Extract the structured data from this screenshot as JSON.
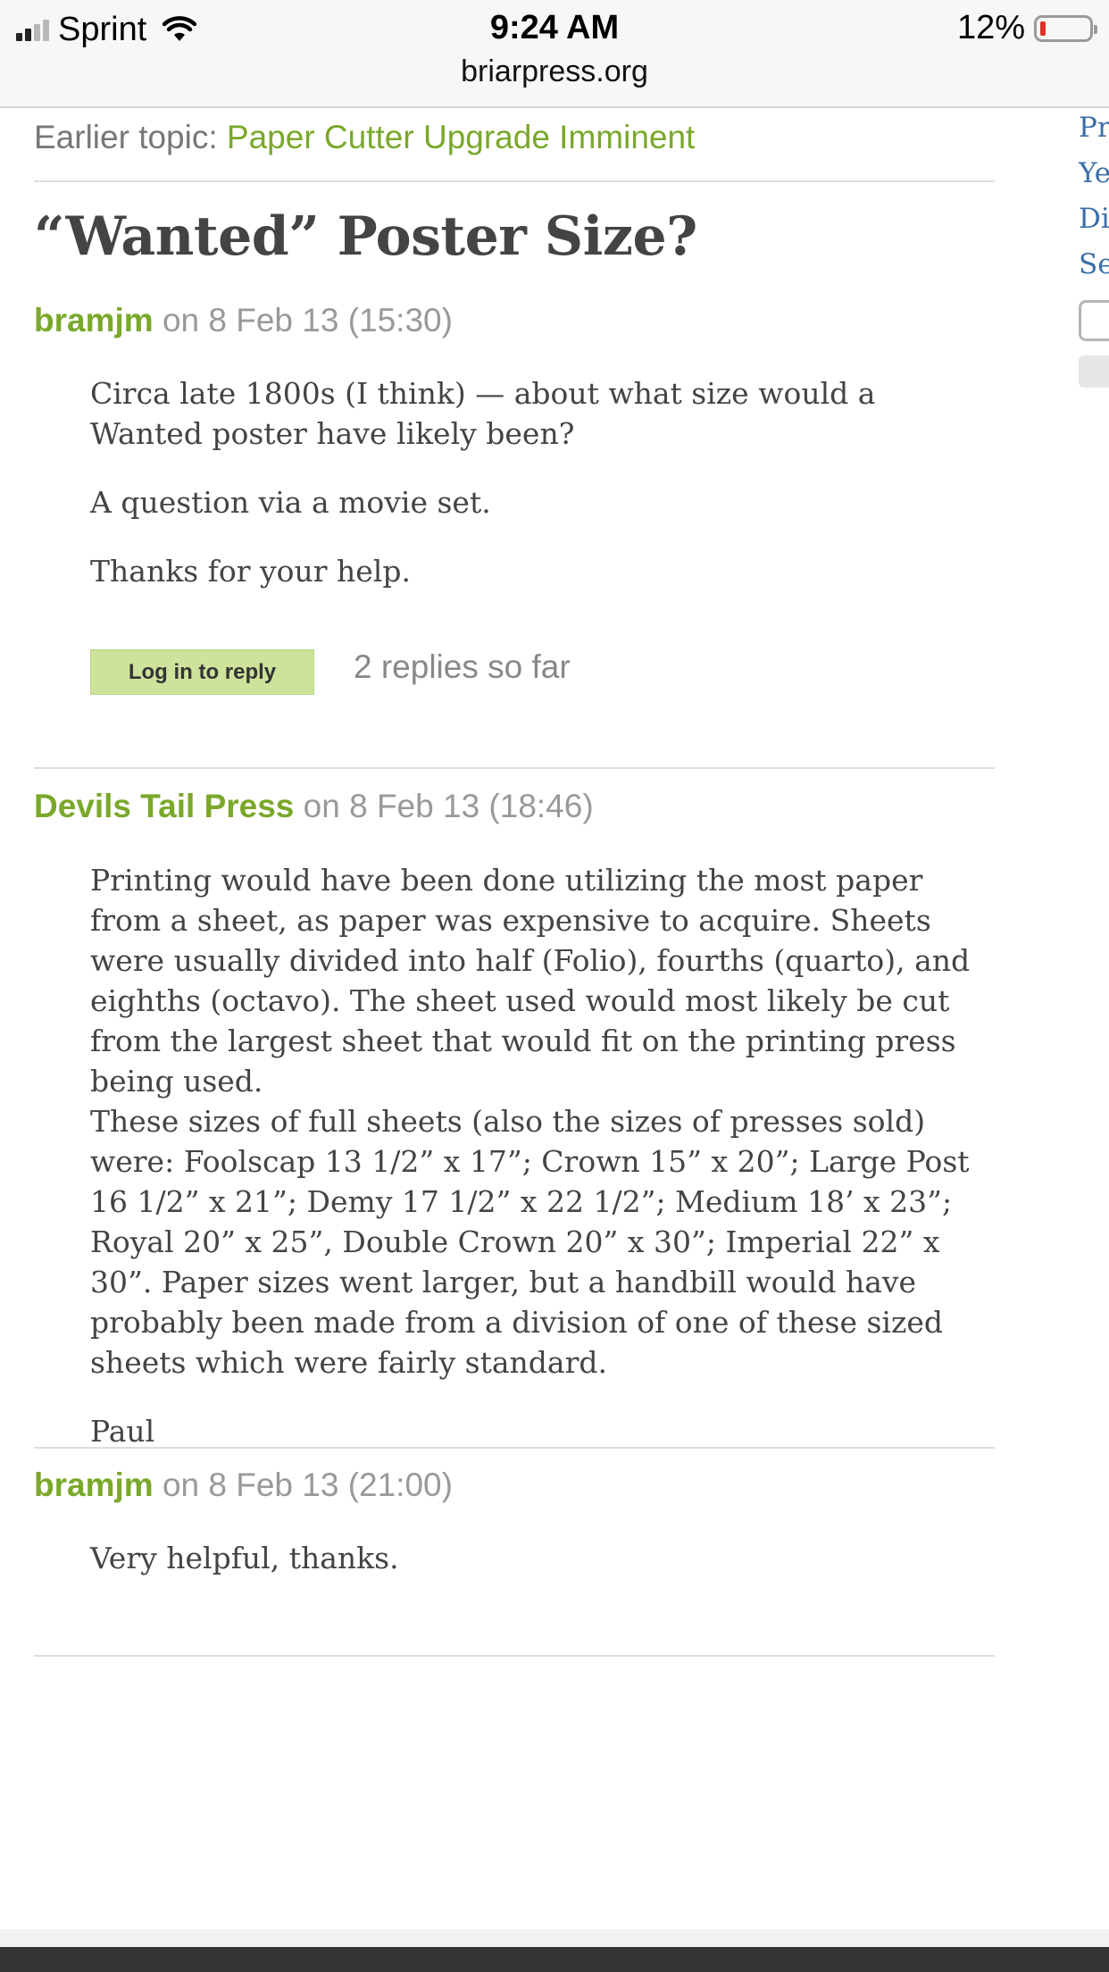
{
  "status_bar": {
    "carrier": "Sprint",
    "time": "9:24 AM",
    "battery_percent": "12%",
    "battery_level": 0.12,
    "url": "briarpress.org"
  },
  "nav": {
    "earlier_label": "Earlier topic:",
    "earlier_link": "Paper Cutter Upgrade Imminent"
  },
  "topic": {
    "title": "“Wanted” Poster Size?",
    "author": "bramjm",
    "date": "on 8 Feb 13 (15:30)",
    "paragraphs": [
      "Circa late 1800s (I think) — about what size would a Wanted poster have likely been?",
      "A question via a movie set.",
      "Thanks for your help."
    ],
    "reply_button": "Log in to reply",
    "replies_count": "2 replies so far"
  },
  "replies": [
    {
      "author": "Devils Tail Press",
      "date": "on 8 Feb 13 (18:46)",
      "paragraphs": [
        "Printing would have been done utilizing the most paper from a sheet, as paper was expensive to acquire. Sheets were usually divided into half (Folio), fourths (quarto), and eighths (octavo). The sheet used would most likely be cut from the largest sheet that would fit on the printing press being used.",
        "These sizes of full sheets (also the sizes of presses sold) were: Foolscap 13 1/2” x 17”; Crown 15” x 20”; Large Post 16 1/2” x 21”; Demy 17 1/2” x 22 1/2”; Medium 18’ x 23”; Royal 20” x 25”, Double Crown 20” x 30”; Imperial 22” x 30”. Paper sizes went larger, but a handbill would have probably been made from a division of one of these sized sheets which were fairly standard.",
        "Paul"
      ]
    },
    {
      "author": "bramjm",
      "date": "on 8 Feb 13 (21:00)",
      "paragraphs": [
        "Very helpful, thanks."
      ]
    }
  ],
  "sidebar": {
    "links": [
      "Pr",
      "Ye",
      "Di",
      "Se"
    ]
  }
}
